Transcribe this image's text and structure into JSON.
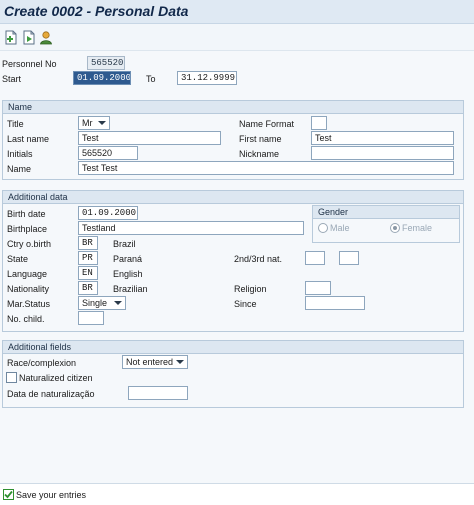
{
  "window": {
    "title": "Create 0002 - Personal Data"
  },
  "toolbar": {
    "buttons": [
      {
        "icon": "new-entry-icon"
      },
      {
        "icon": "copy-entry-icon"
      },
      {
        "icon": "person-overview-icon"
      }
    ]
  },
  "header": {
    "personnel_no_label": "Personnel No",
    "personnel_no": "565520",
    "start_label": "Start",
    "start_date": "01.09.2000",
    "to_label": "To",
    "end_date": "31.12.9999"
  },
  "name_group": {
    "title": "Name",
    "title_label": "Title",
    "title_value": "Mr",
    "name_format_label": "Name Format",
    "name_format_value": "",
    "last_name_label": "Last name",
    "last_name": "Test",
    "first_name_label": "First name",
    "first_name": "Test",
    "initials_label": "Initials",
    "initials": "565520",
    "nickname_label": "Nickname",
    "nickname": "",
    "name_label": "Name",
    "full_name": "Test Test"
  },
  "additional_data": {
    "title": "Additional data",
    "birth_date_label": "Birth date",
    "birth_date": "01.09.2000",
    "birthplace_label": "Birthplace",
    "birthplace": "Testland",
    "ctry_birth_label": "Ctry o.birth",
    "ctry_birth_code": "BR",
    "ctry_birth_text": "Brazil",
    "state_label": "State",
    "state_code": "PR",
    "state_text": "Paraná",
    "language_label": "Language",
    "language_code": "EN",
    "language_text": "English",
    "nationality_label": "Nationality",
    "nationality_code": "BR",
    "nationality_text": "Brazilian",
    "marital_status_label": "Mar.Status",
    "marital_status": "Single",
    "no_children_label": "No. child.",
    "no_children": "",
    "nat_23_label": "2nd/3rd nat.",
    "nat_2": "",
    "nat_3": "",
    "religion_label": "Religion",
    "religion": "",
    "since_label": "Since",
    "since": "",
    "gender": {
      "title": "Gender",
      "male_label": "Male",
      "female_label": "Female",
      "selected": "Female"
    }
  },
  "additional_fields": {
    "title": "Additional fields",
    "race_label": "Race/complexion",
    "race_value": "Not entered",
    "naturalized_label": "Naturalized citizen",
    "naturalized_checked": false,
    "naturalization_date_label": "Data de naturalização",
    "naturalization_date": ""
  },
  "status": {
    "message": "Save your entries",
    "accent": "#2f8f2f"
  },
  "colors": {
    "title_bar": "#dfe9f3",
    "group_header": "#dde7f1",
    "selected_field": "#2e5a8f"
  }
}
